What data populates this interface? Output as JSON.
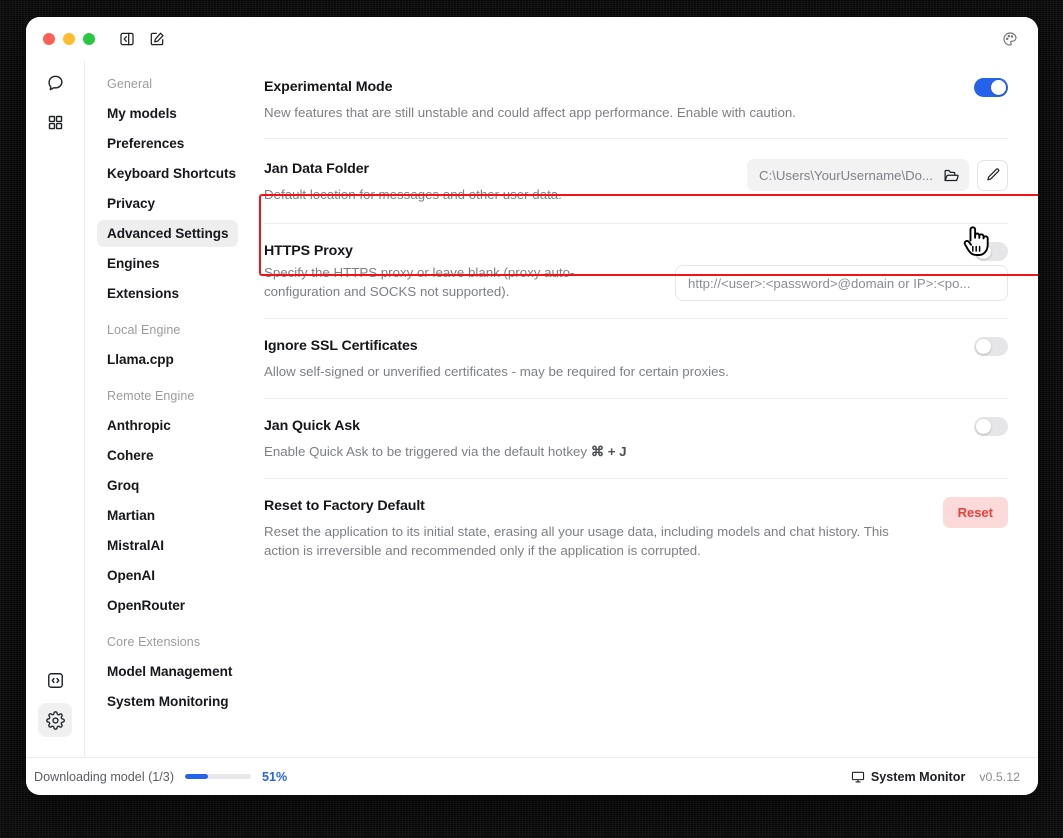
{
  "window": {
    "titlebar": {
      "traffic_lights": [
        "close",
        "minimize",
        "maximize"
      ],
      "collapse_panel_icon": "panel-collapse-icon",
      "compose_icon": "compose-icon",
      "theme_icon": "palette-icon"
    }
  },
  "rail": {
    "top_items": [
      {
        "icon": "chat-bubble-icon",
        "name": "chat"
      },
      {
        "icon": "grid-icon",
        "name": "hub"
      }
    ],
    "bottom_items": [
      {
        "icon": "code-icon",
        "name": "local-api-server",
        "active": false
      },
      {
        "icon": "gear-icon",
        "name": "settings",
        "active": true
      }
    ]
  },
  "sidebar": {
    "groups": [
      {
        "label": "General",
        "items": [
          {
            "label": "My models",
            "active": false
          },
          {
            "label": "Preferences",
            "active": false
          },
          {
            "label": "Keyboard Shortcuts",
            "active": false
          },
          {
            "label": "Privacy",
            "active": false
          },
          {
            "label": "Advanced Settings",
            "active": true
          },
          {
            "label": "Engines",
            "active": false
          },
          {
            "label": "Extensions",
            "active": false
          }
        ]
      },
      {
        "label": "Local Engine",
        "items": [
          {
            "label": "Llama.cpp",
            "active": false
          }
        ]
      },
      {
        "label": "Remote Engine",
        "items": [
          {
            "label": "Anthropic",
            "active": false
          },
          {
            "label": "Cohere",
            "active": false
          },
          {
            "label": "Groq",
            "active": false
          },
          {
            "label": "Martian",
            "active": false
          },
          {
            "label": "MistralAI",
            "active": false
          },
          {
            "label": "OpenAI",
            "active": false
          },
          {
            "label": "OpenRouter",
            "active": false
          }
        ]
      },
      {
        "label": "Core Extensions",
        "items": [
          {
            "label": "Model Management",
            "active": false
          },
          {
            "label": "System Monitoring",
            "active": false
          }
        ]
      }
    ]
  },
  "settings": {
    "experimental_mode": {
      "title": "Experimental Mode",
      "description": "New features that are still unstable and could affect app performance. Enable with caution.",
      "toggle_state": "on"
    },
    "jan_data_folder": {
      "title": "Jan Data Folder",
      "description": "Default location for messages and other user data.",
      "path_value": "C:\\Users\\YourUsername\\Do...",
      "folder_icon": "folder-open-icon",
      "edit_icon": "pencil-icon",
      "highlighted": true
    },
    "https_proxy": {
      "title": "HTTPS Proxy",
      "description": "Specify the HTTPS proxy or leave blank (proxy auto-configuration and SOCKS not supported).",
      "input_placeholder": "http://<user>:<password>@domain or IP>:<po...",
      "input_value": "",
      "toggle_state": "off"
    },
    "ignore_ssl": {
      "title": "Ignore SSL Certificates",
      "description": "Allow self-signed or unverified certificates - may be required for certain proxies.",
      "toggle_state": "off"
    },
    "jan_quick_ask": {
      "title": "Jan Quick Ask",
      "description_before": "Enable Quick Ask to be triggered via the default hotkey ",
      "hotkey": "⌘ + J",
      "toggle_state": "off"
    },
    "reset_factory": {
      "title": "Reset to Factory Default",
      "description": "Reset the application to its initial state, erasing all your usage data, including models and chat history. This action is irreversible and recommended only if the application is corrupted.",
      "button_label": "Reset"
    }
  },
  "statusbar": {
    "download_label": "Downloading model (1/3)",
    "progress_percent_label": "51%",
    "progress_fill_ratio": 35,
    "system_monitor_label": "System Monitor",
    "system_monitor_icon": "monitor-icon",
    "version": "v0.5.12"
  },
  "colors": {
    "accent_blue": "#2563eb",
    "highlight_red": "#f21414",
    "reset_bg": "#fcdada",
    "reset_text": "#e8403a",
    "traffic_red": "#ff5f57",
    "traffic_yellow": "#febc2e",
    "traffic_green": "#28c840"
  }
}
